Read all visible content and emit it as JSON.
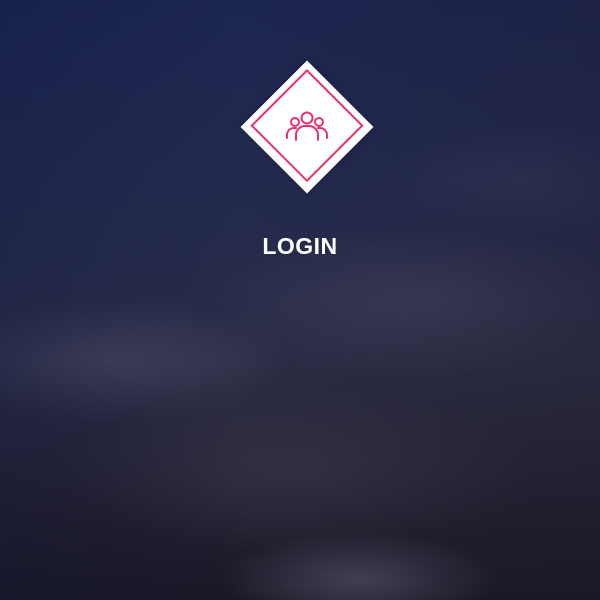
{
  "login": {
    "title": "LOGIN"
  },
  "logo": {
    "icon": "users-group-icon",
    "accent_color": "#e8336d",
    "badge_color": "#ffffff"
  },
  "background": {
    "description_colors": [
      "#1c2550",
      "#2b2d46",
      "#1a1826"
    ]
  }
}
